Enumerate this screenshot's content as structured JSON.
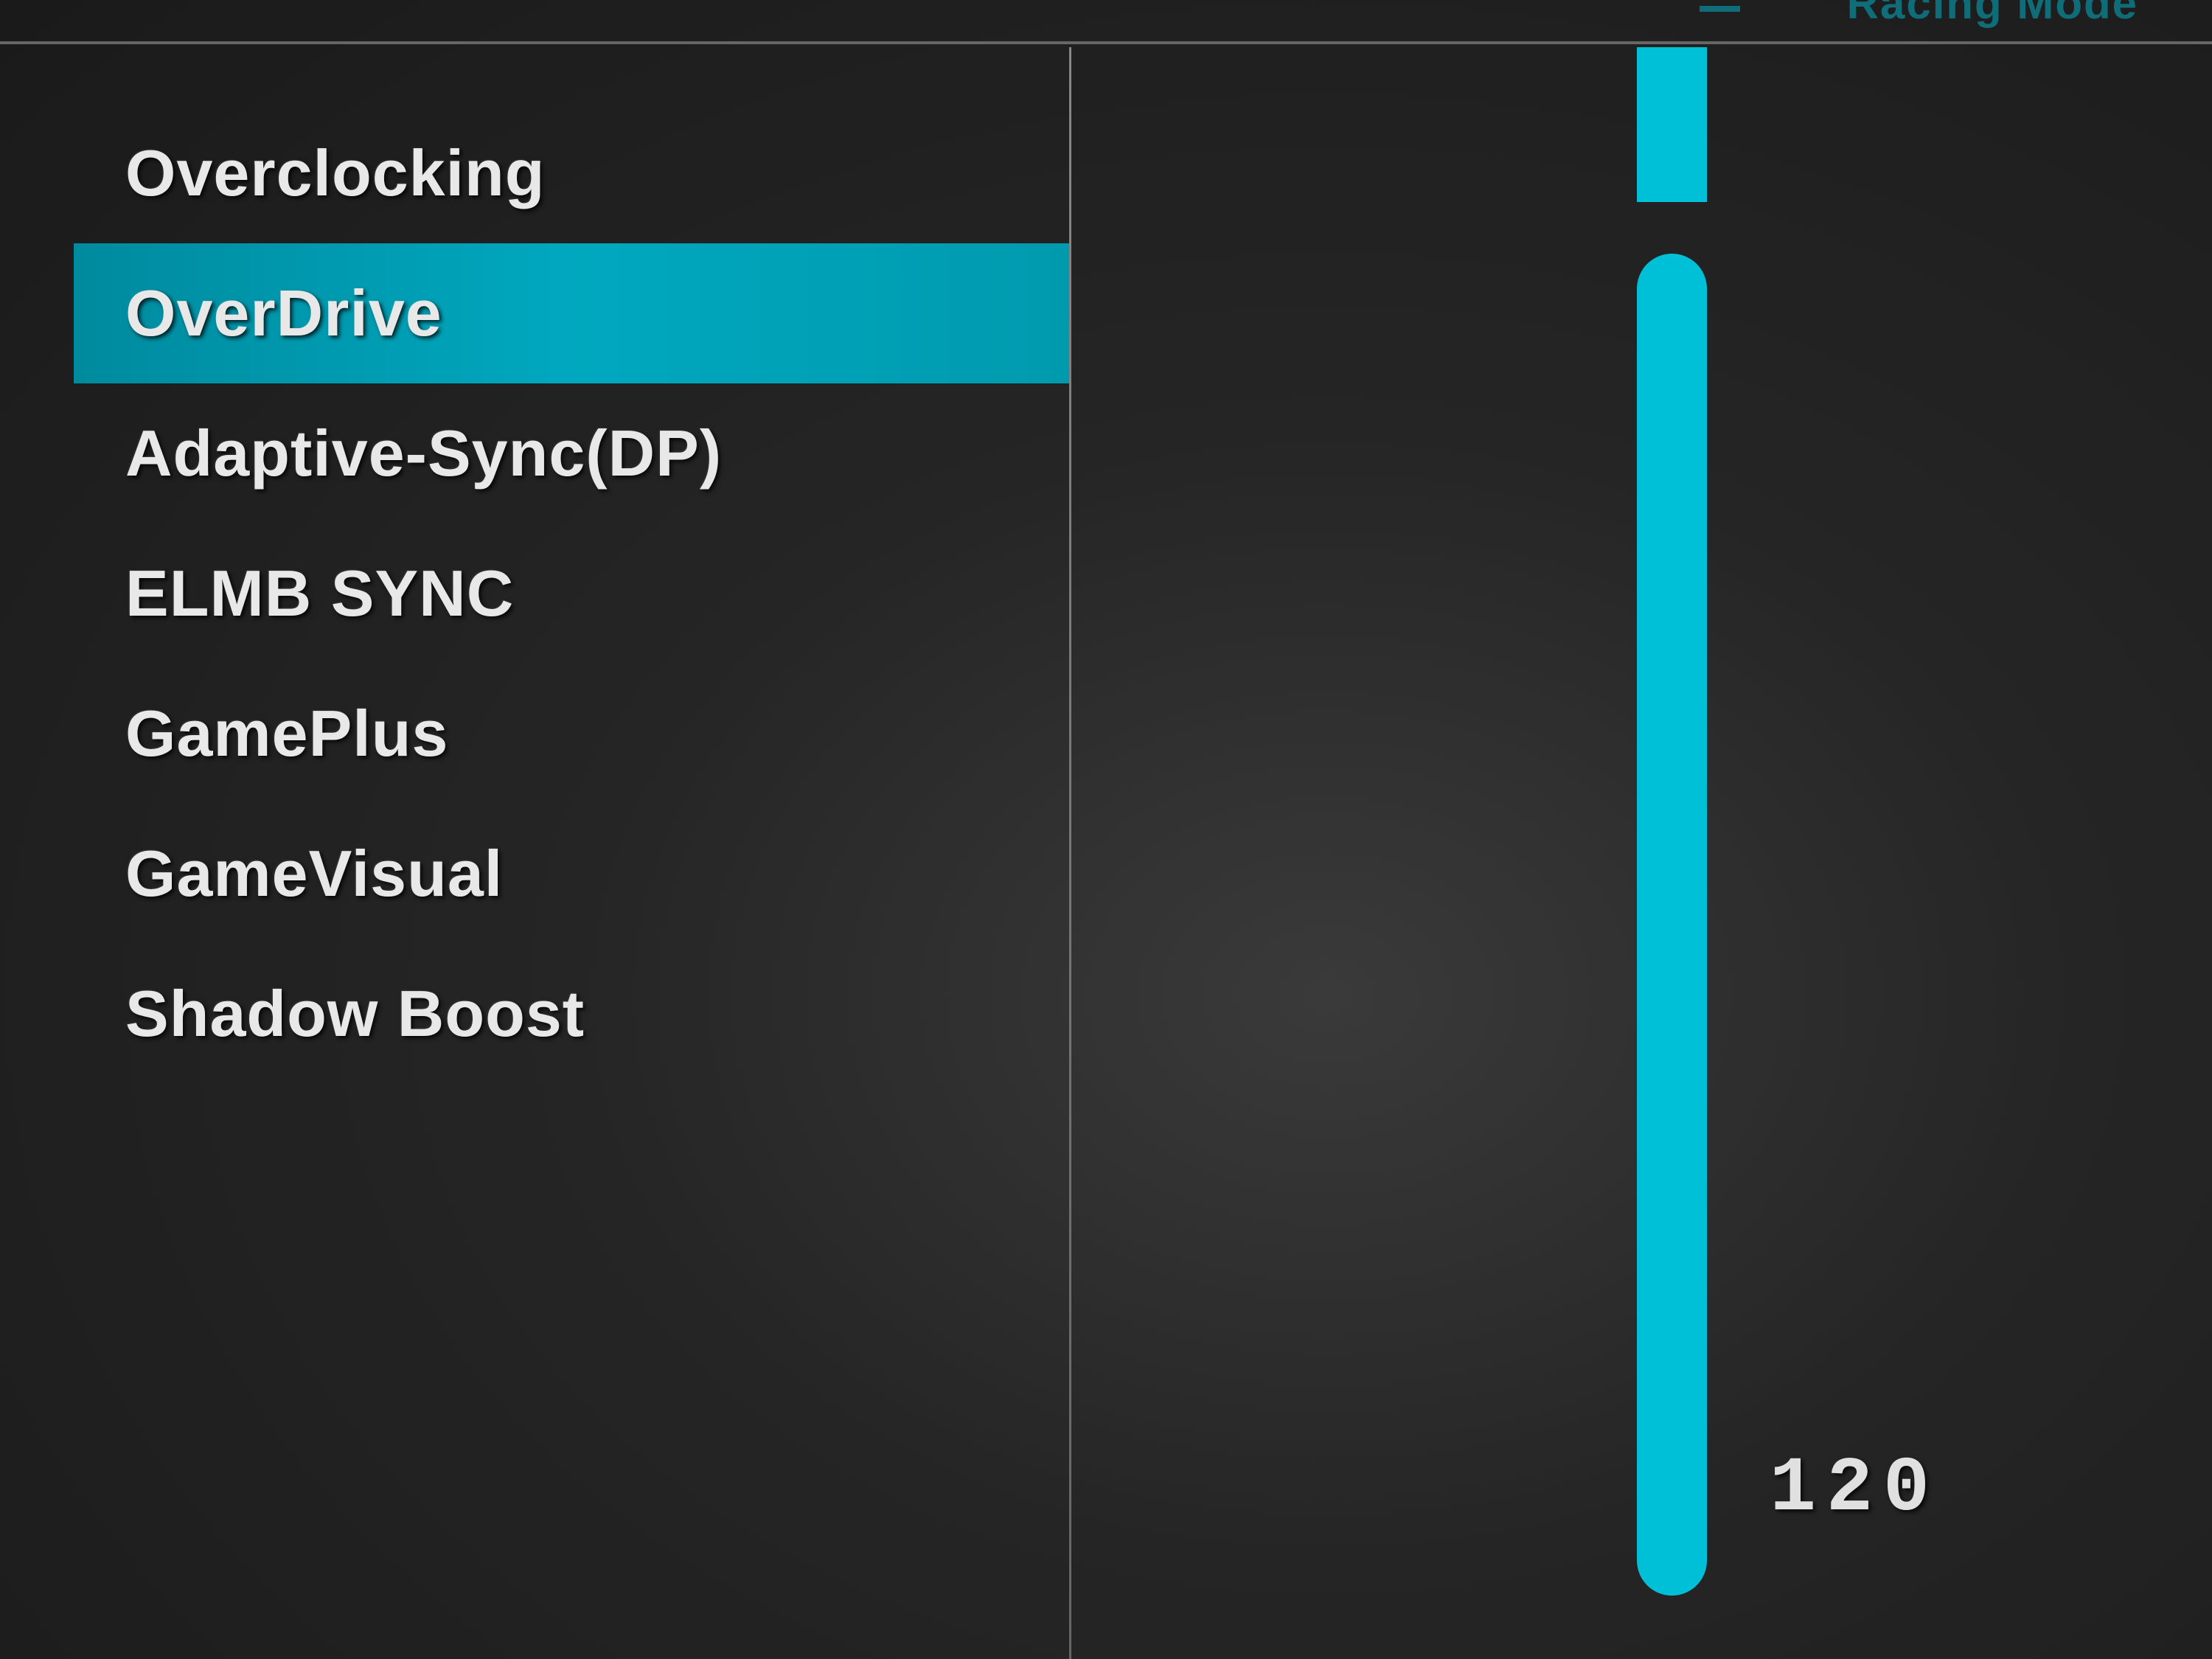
{
  "header": {
    "mode_label": "Racing Mode"
  },
  "menu": {
    "items": [
      {
        "label": "Overclocking",
        "selected": false
      },
      {
        "label": "OverDrive",
        "selected": true
      },
      {
        "label": "Adaptive-Sync(DP)",
        "selected": false
      },
      {
        "label": "ELMB SYNC",
        "selected": false
      },
      {
        "label": "GamePlus",
        "selected": false
      },
      {
        "label": "GameVisual",
        "selected": false
      },
      {
        "label": "Shadow Boost",
        "selected": false
      }
    ]
  },
  "slider": {
    "value": "120"
  },
  "colors": {
    "accent": "#00c0d8",
    "background": "#1a1a1a",
    "text": "#e8e8e8"
  }
}
